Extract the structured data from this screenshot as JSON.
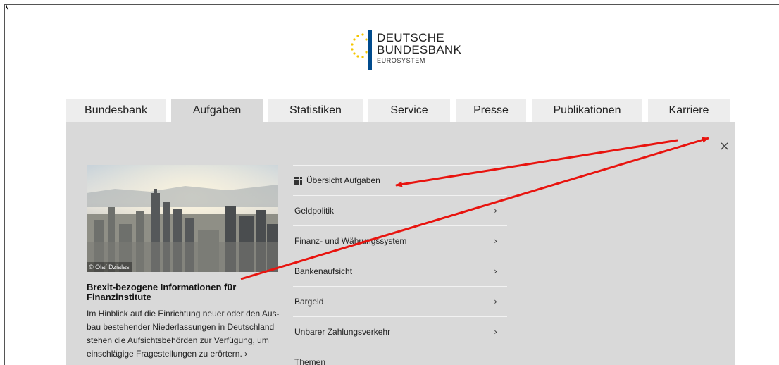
{
  "corner_text": "(",
  "logo": {
    "line1": "DEUTSCHE",
    "line2": "BUNDESBANK",
    "line3": "EUROSYSTEM"
  },
  "nav": {
    "tabs": [
      "Bundesbank",
      "Aufgaben",
      "Statistiken",
      "Service",
      "Presse",
      "Publikationen",
      "Karriere"
    ],
    "active": "Aufgaben"
  },
  "panel": {
    "close_symbol": "×",
    "teaser": {
      "credit": "© Olaf Dzialas",
      "title": "Brexit-bezogene Informationen für Finanzinstitute",
      "text": "Im Hinblick auf die Einrichtung neuer oder den Aus-bau bestehender Niederlassungen in Deutschland stehen die Aufsichtsbehörden zur Verfügung, um einschlägige Fragestellungen zu erörtern.",
      "more_symbol": "›"
    },
    "submenu": {
      "overview_label": "Übersicht Aufgaben",
      "items": [
        "Geldpolitik",
        "Finanz- und Währungssystem",
        "Bankenaufsicht",
        "Bargeld",
        "Unbarer Zahlungsverkehr",
        "Themen"
      ],
      "chevron": "›"
    }
  },
  "colors": {
    "tab_bg": "#ededed",
    "panel_bg": "#d9d9d9",
    "logo_blue": "#004b8d",
    "logo_stars": "#f4c500",
    "annotation_red": "#e8140f"
  }
}
